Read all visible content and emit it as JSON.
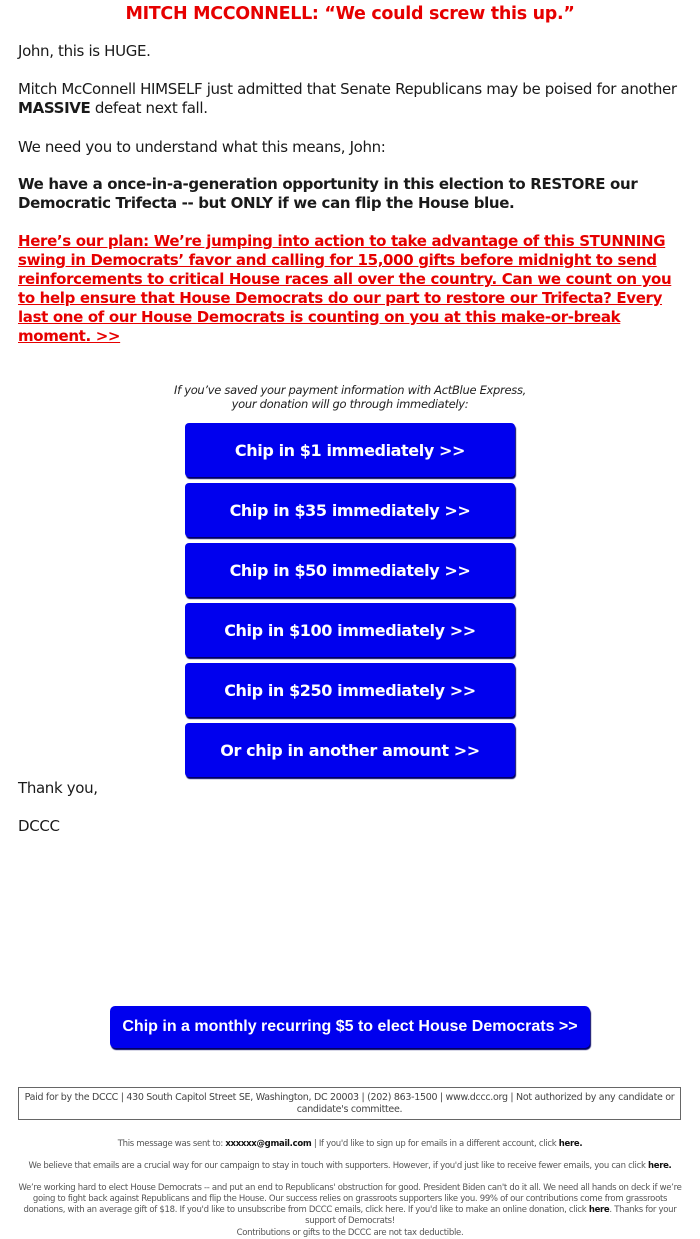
{
  "headline": "MITCH MCCONNELL: “We could screw this up.”",
  "paragraphs": {
    "greeting": "John, this is HUGE.",
    "admission_prefix": "Mitch McConnell HIMSELF just admitted that Senate Republicans may be poised for another ",
    "admission_bold": "MASSIVE",
    "admission_suffix": " defeat next fall.",
    "understand": "We need you to understand what this means, John:",
    "opportunity": "We have a once-in-a-generation opportunity in this election to RESTORE our Democratic Trifecta -- but ONLY if we can flip the House blue.",
    "plan_link": "Here’s our plan: We’re jumping into action to take advantage of this STUNNING swing in Democrats’ favor and calling for 15,000 gifts before midnight to send reinforcements to critical House races all over the country. Can we count on you to help ensure that House Democrats do our part to restore our Trifecta? Every last one of our House Democrats is counting on you at this make-or-break moment. >>"
  },
  "actblue_note": "If you’ve saved your payment information with ActBlue Express, your donation will go through immediately:",
  "donate_buttons": [
    {
      "label": "Chip in $1 immediately >>"
    },
    {
      "label": "Chip in $35 immediately >>"
    },
    {
      "label": "Chip in $50 immediately >>"
    },
    {
      "label": "Chip in $100 immediately >>"
    },
    {
      "label": "Chip in $250 immediately >>"
    },
    {
      "label": "Or chip in another amount >>"
    }
  ],
  "closing": {
    "thanks": "Thank you,",
    "signature": "DCCC"
  },
  "monthly_button": "Chip in a monthly recurring $5 to elect House Democrats >>",
  "footer": {
    "disclaimer": "Paid for by the DCCC | 430 South Capitol Street SE, Washington, DC 20003 | (202) 863-1500 | www.dccc.org | Not authorized by any candidate or candidate's committee.",
    "sent_to_prefix": "This message was sent to: ",
    "sent_to_email": "xxxxxx@gmail.com",
    "sent_to_suffix": " | If you'd like to sign up for emails in a different account, click ",
    "here": "here.",
    "fewer_emails": "We believe that emails are a crucial way for our campaign to stay in touch with supporters. However, if you'd just like to receive fewer emails, you can click ",
    "working_hard": "We’re working hard to elect House Democrats -- and put an end to Republicans' obstruction for good. President Biden can't do it all. We need all hands on deck if we’re going to fight back against Republicans and flip the House. Our success relies on grassroots supporters like you. 99% of our contributions come from grassroots donations, with an average gift of $18. If you'd like to unsubscribe from DCCC emails, click here. If you'd like to make an online donation, click ",
    "donation_here": "here",
    "working_hard_end": ". Thanks for your support of Democrats!",
    "tax": "Contributions or gifts to the DCCC are not tax deductible."
  }
}
